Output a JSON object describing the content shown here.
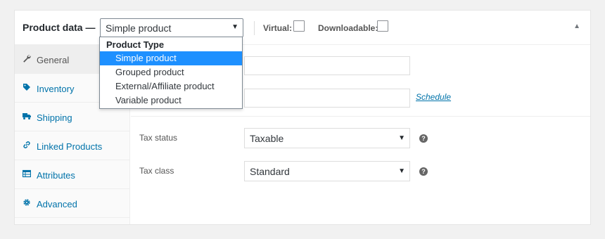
{
  "header": {
    "title": "Product data —",
    "selected_type": "Simple product",
    "virtual_label": "Virtual:",
    "downloadable_label": "Downloadable:"
  },
  "dropdown": {
    "group_label": "Product Type",
    "options": [
      "Simple product",
      "Grouped product",
      "External/Affiliate product",
      "Variable product"
    ],
    "selected_index": 0
  },
  "tabs": [
    {
      "label": "General",
      "icon": "wrench-icon",
      "active": true
    },
    {
      "label": "Inventory",
      "icon": "tag-icon",
      "active": false
    },
    {
      "label": "Shipping",
      "icon": "truck-icon",
      "active": false
    },
    {
      "label": "Linked Products",
      "icon": "link-icon",
      "active": false
    },
    {
      "label": "Attributes",
      "icon": "table-icon",
      "active": false
    },
    {
      "label": "Advanced",
      "icon": "gear-icon",
      "active": false
    }
  ],
  "general": {
    "schedule_link": "Schedule",
    "tax_status_label": "Tax status",
    "tax_status_value": "Taxable",
    "tax_class_label": "Tax class",
    "tax_class_value": "Standard",
    "help_glyph": "?"
  },
  "colors": {
    "accent": "#0073aa",
    "highlight": "#1e90ff",
    "background": "#f1f1f1"
  }
}
